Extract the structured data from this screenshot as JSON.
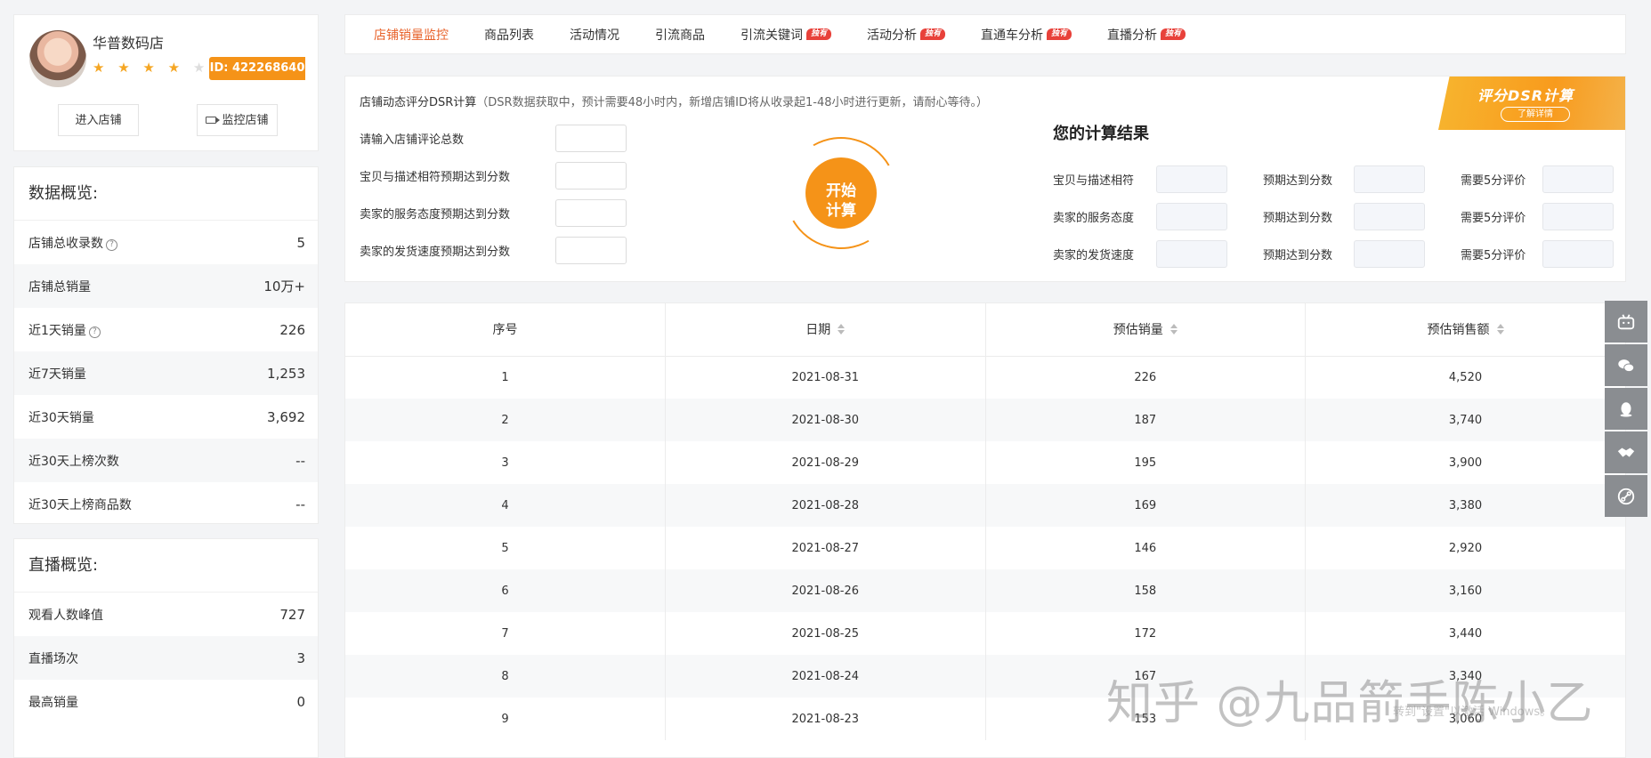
{
  "store": {
    "name": "华普数码店",
    "stars_on": "★ ★ ★ ★",
    "stars_off": "★",
    "id_label": "ID: 422268640",
    "enter_label": "进入店铺",
    "monitor_label": "监控店铺"
  },
  "overview": {
    "title": "数据概览:",
    "rows": [
      {
        "label": "店铺总收录数",
        "value": "5"
      },
      {
        "label": "店铺总销量",
        "value": "10万+"
      },
      {
        "label": "近1天销量",
        "value": "226"
      },
      {
        "label": "近7天销量",
        "value": "1,253"
      },
      {
        "label": "近30天销量",
        "value": "3,692"
      },
      {
        "label": "近30天上榜次数",
        "value": "--"
      },
      {
        "label": "近30天上榜商品数",
        "value": "--"
      }
    ]
  },
  "live": {
    "title": "直播概览:",
    "rows": [
      {
        "label": "观看人数峰值",
        "value": "727"
      },
      {
        "label": "直播场次",
        "value": "3"
      },
      {
        "label": "最高销量",
        "value": "0"
      }
    ]
  },
  "tabs": {
    "items": [
      {
        "label": "店铺销量监控"
      },
      {
        "label": "商品列表"
      },
      {
        "label": "活动情况"
      },
      {
        "label": "引流商品"
      },
      {
        "label": "引流关键词",
        "tag": "独有"
      },
      {
        "label": "活动分析",
        "tag": "独有"
      },
      {
        "label": "直通车分析",
        "tag": "独有"
      },
      {
        "label": "直播分析",
        "tag": "独有"
      }
    ]
  },
  "dsr": {
    "title": "店铺动态评分DSR计算",
    "note": "（DSR数据获取中，预计需要48小时内，新增店铺ID将从收录起1-48小时进行更新，请耐心等待。）",
    "promo_title": "评分DSR计算",
    "promo_button": "了解详情",
    "inputs": [
      "请输入店铺评论总数",
      "宝贝与描述相符预期达到分数",
      "卖家的服务态度预期达到分数",
      "卖家的发货速度预期达到分数"
    ],
    "start_line1": "开始",
    "start_line2": "计算",
    "result_title": "您的计算结果",
    "result_rows": [
      {
        "label": "宝贝与描述相符",
        "expect": "预期达到分数",
        "need": "需要5分评价"
      },
      {
        "label": "卖家的服务态度",
        "expect": "预期达到分数",
        "need": "需要5分评价"
      },
      {
        "label": "卖家的发货速度",
        "expect": "预期达到分数",
        "need": "需要5分评价"
      }
    ]
  },
  "table": {
    "headers": [
      "序号",
      "日期",
      "预估销量",
      "预估销售额"
    ],
    "rows": [
      [
        "1",
        "2021-08-31",
        "226",
        "4,520"
      ],
      [
        "2",
        "2021-08-30",
        "187",
        "3,740"
      ],
      [
        "3",
        "2021-08-29",
        "195",
        "3,900"
      ],
      [
        "4",
        "2021-08-28",
        "169",
        "3,380"
      ],
      [
        "5",
        "2021-08-27",
        "146",
        "2,920"
      ],
      [
        "6",
        "2021-08-26",
        "158",
        "3,160"
      ],
      [
        "7",
        "2021-08-25",
        "172",
        "3,440"
      ],
      [
        "8",
        "2021-08-24",
        "167",
        "3,340"
      ],
      [
        "9",
        "2021-08-23",
        "153",
        "3,060"
      ]
    ]
  },
  "side_icons": [
    "bilibili-icon",
    "wechat-icon",
    "qq-icon",
    "handshake-icon",
    "link-icon"
  ],
  "watermark": "知乎 @九品箭手陈小乙",
  "windows_hint": "转到\"设置\"以激活 Windows。",
  "colors": {
    "accent": "#f59318",
    "active_tab": "#e8632b",
    "tag": "#e8413a"
  }
}
